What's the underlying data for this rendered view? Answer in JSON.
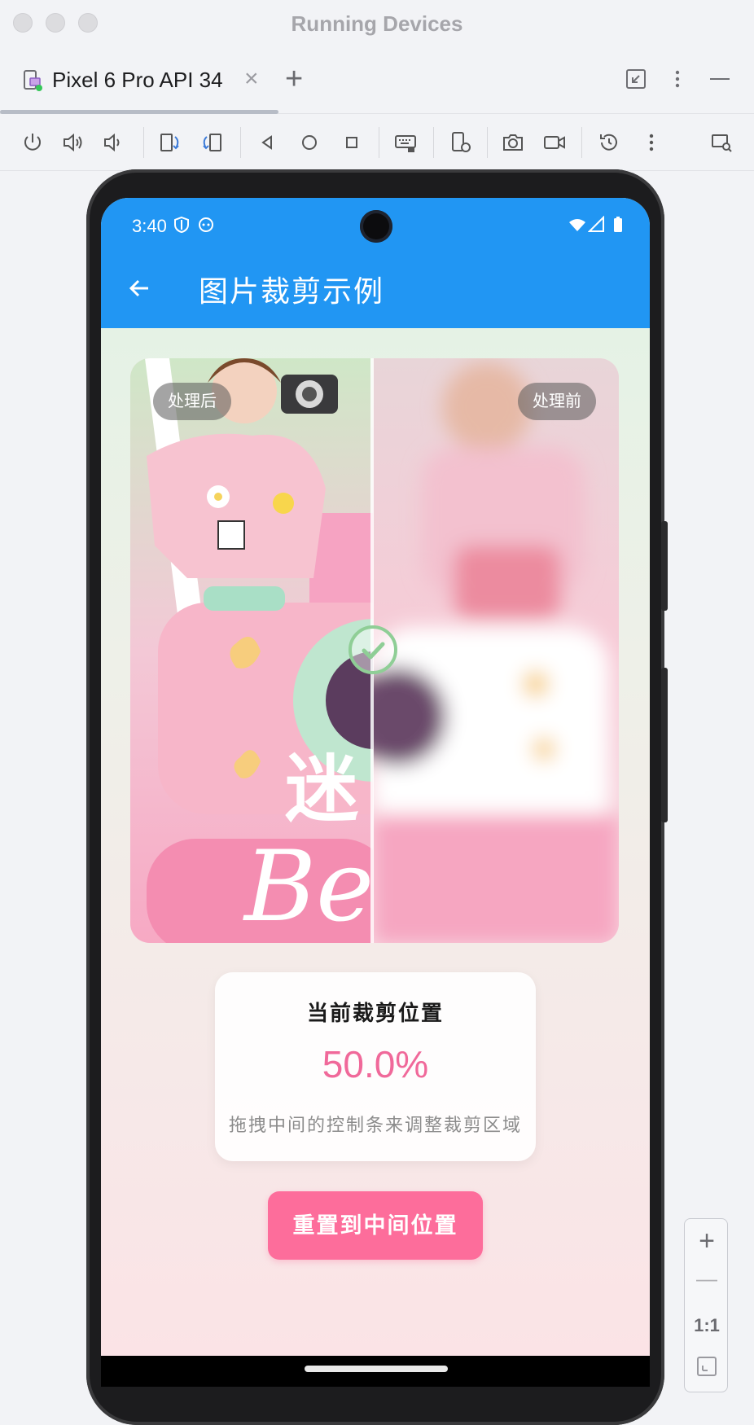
{
  "window": {
    "title": "Running Devices"
  },
  "tabs": [
    {
      "label": "Pixel 6 Pro API 34",
      "close": "×"
    }
  ],
  "tabbar": {
    "add": "+"
  },
  "toolbar": {
    "icons": [
      "power-icon",
      "volume-up-icon",
      "volume-down-icon",
      "rotate-left-icon",
      "rotate-right-icon",
      "back-icon",
      "home-icon",
      "overview-icon",
      "keyboard-icon",
      "device-settings-icon",
      "screenshot-icon",
      "screen-record-icon",
      "reset-icon",
      "more-icon",
      "device-mirror-icon"
    ]
  },
  "device": {
    "status_bar": {
      "time": "3:40"
    },
    "app_bar": {
      "title": "图片裁剪示例"
    },
    "compare": {
      "after_label": "处理后",
      "before_label": "处理前",
      "split_position": 0.5
    },
    "info_card": {
      "title": "当前裁剪位置",
      "value": "50.0%",
      "hint": "拖拽中间的控制条来调整裁剪区域"
    },
    "reset_button": "重置到中间位置"
  },
  "zoom": {
    "plus": "+",
    "minus": "—",
    "ratio": "1:1"
  },
  "colors": {
    "app_bar": "#2196f3",
    "accent_pink": "#fd6d9b",
    "value_pink": "#f0699a",
    "handle_green": "#8fce96"
  }
}
